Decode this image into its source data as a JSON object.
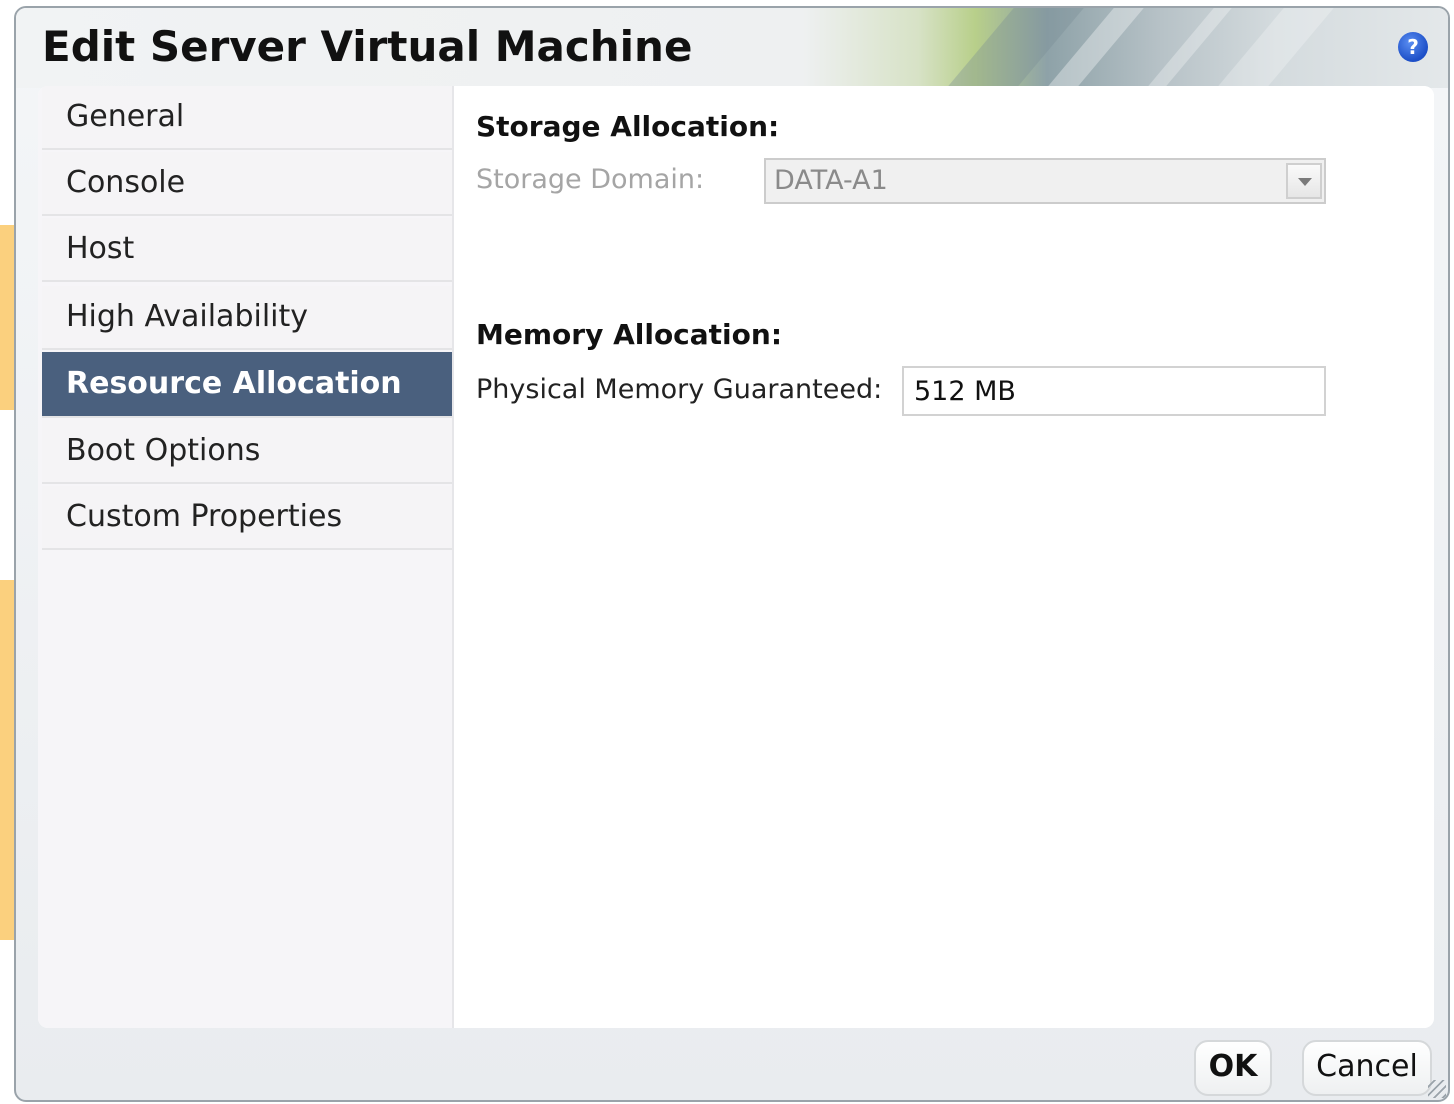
{
  "dialog": {
    "title": "Edit Server Virtual Machine",
    "help_symbol": "?"
  },
  "sidebar": {
    "items": [
      {
        "label": "General"
      },
      {
        "label": "Console"
      },
      {
        "label": "Host"
      },
      {
        "label": "High Availability"
      },
      {
        "label": "Resource Allocation",
        "selected": true
      },
      {
        "label": "Boot Options"
      },
      {
        "label": "Custom Properties"
      }
    ]
  },
  "storage": {
    "section_title": "Storage Allocation:",
    "domain_label": "Storage Domain:",
    "domain_value": "DATA-A1"
  },
  "memory": {
    "section_title": "Memory Allocation:",
    "guaranteed_label": "Physical Memory Guaranteed:",
    "guaranteed_value": "512 MB"
  },
  "footer": {
    "ok_label": "OK",
    "cancel_label": "Cancel"
  },
  "colors": {
    "selected_nav_bg": "#4a607e",
    "help_icon": "#1d4fc7"
  },
  "icons": [
    "help-icon",
    "chevron-down-icon",
    "resize-grip-icon"
  ]
}
